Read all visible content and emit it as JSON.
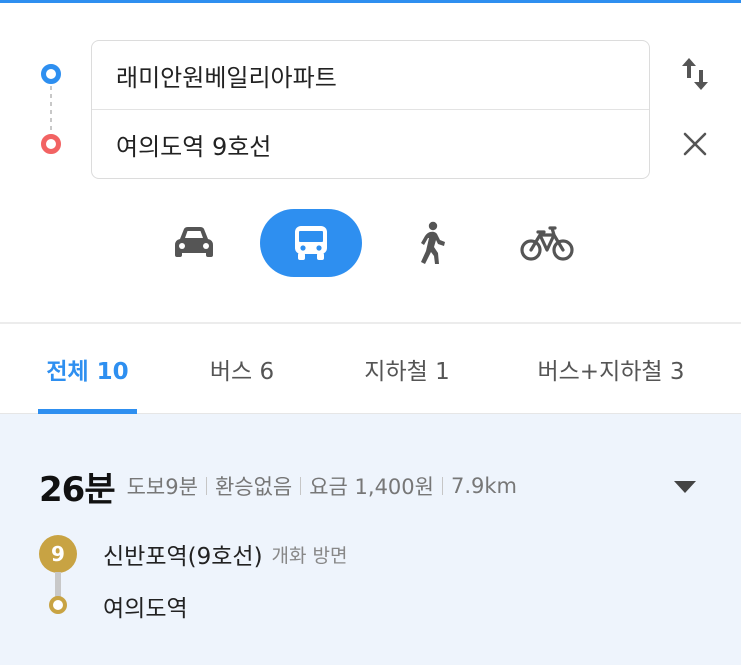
{
  "route": {
    "origin": "래미안원베일리아파트",
    "destination": "여의도역 9호선"
  },
  "icons": {
    "swap": "swap-vertical-icon",
    "clear": "close-icon",
    "car": "car-icon",
    "transit": "bus-icon",
    "walk": "walk-icon",
    "bike": "bicycle-icon"
  },
  "tabs": [
    {
      "label": "전체 10",
      "active": true
    },
    {
      "label": "버스 6",
      "active": false
    },
    {
      "label": "지하철 1",
      "active": false
    },
    {
      "label": "버스+지하철 3",
      "active": false
    }
  ],
  "result": {
    "time": "26분",
    "walk": "도보9분",
    "transfer": "환승없음",
    "fare": "요금 1,400원",
    "distance": "7.9km",
    "line_badge": "9",
    "start_stop": "신반포역(9호선)",
    "start_direction": "개화 방면",
    "end_stop": "여의도역"
  },
  "colors": {
    "accent": "#2e8ff0",
    "destination": "#f26363",
    "line9": "#c8a343",
    "result_bg": "#eef4fc"
  }
}
